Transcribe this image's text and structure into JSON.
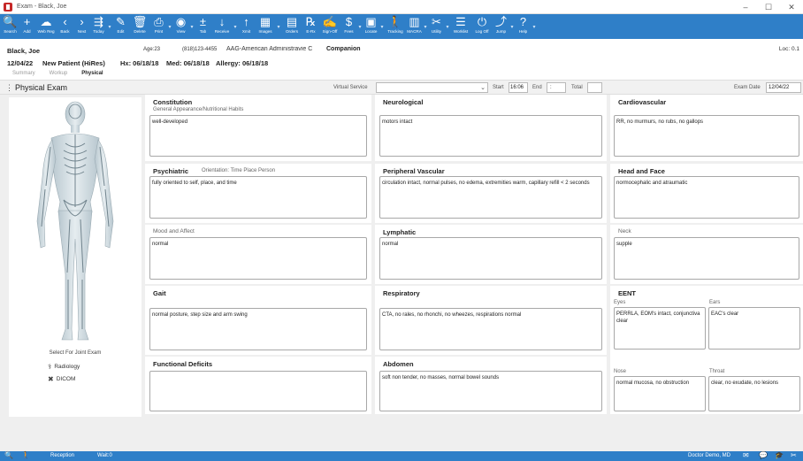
{
  "window": {
    "title": "Exam - Black, Joe",
    "controls": [
      "–",
      "☐",
      "✕"
    ]
  },
  "toolbar": [
    {
      "label": "Search",
      "icon": "🔍",
      "name": "search"
    },
    {
      "label": "Add",
      "icon": "+",
      "name": "add"
    },
    {
      "label": "Web Reg",
      "icon": "☁",
      "name": "web-reg"
    },
    {
      "label": "Back",
      "icon": "‹",
      "name": "back"
    },
    {
      "label": "Next",
      "icon": "›",
      "name": "next"
    },
    {
      "label": "Today",
      "icon": "⇶",
      "name": "today"
    },
    {
      "label": "Edit",
      "icon": "✎",
      "name": "edit"
    },
    {
      "label": "Delete",
      "icon": "🗑",
      "name": "delete"
    },
    {
      "label": "Print",
      "icon": "⎙",
      "name": "print"
    },
    {
      "label": "View",
      "icon": "◉",
      "name": "view"
    },
    {
      "label": "Tab",
      "icon": "±",
      "name": "tab"
    },
    {
      "label": "Receive",
      "icon": "↓",
      "name": "receive"
    },
    {
      "label": "Xmit",
      "icon": "↑",
      "name": "xmit"
    },
    {
      "label": "Images",
      "icon": "▦",
      "name": "images"
    },
    {
      "label": "Orders",
      "icon": "▤",
      "name": "orders"
    },
    {
      "label": "E-Rx",
      "icon": "℞",
      "name": "e-rx"
    },
    {
      "label": "Sign-Off",
      "icon": "✍",
      "name": "sign-off"
    },
    {
      "label": "Fees",
      "icon": "$",
      "name": "fees"
    },
    {
      "label": "Locate",
      "icon": "▣",
      "name": "locate"
    },
    {
      "label": "Tracking",
      "icon": "🚶",
      "name": "tracking"
    },
    {
      "label": "MACRA",
      "icon": "▥",
      "name": "macra"
    },
    {
      "label": "Utility",
      "icon": "✂",
      "name": "utility"
    },
    {
      "label": "Worklist",
      "icon": "☰",
      "name": "worklist"
    },
    {
      "label": "Log Off",
      "icon": "⏻",
      "name": "log-off"
    },
    {
      "label": "Jump",
      "icon": "⤴",
      "name": "jump"
    },
    {
      "label": "Help",
      "icon": "?",
      "name": "help"
    }
  ],
  "patient": {
    "name": "Black, Joe",
    "age": "Age:23",
    "phone": "(818)123-4455",
    "insurance": "AAG-American Administravie C",
    "companion": "Companion",
    "loc": "Loc: 0.1",
    "date": "12/04/22",
    "visit": "New Patient (HiRes)",
    "hx": "Hx: 06/18/18",
    "med": "Med: 06/18/18",
    "allergy": "Allergy: 06/18/18",
    "tabs": [
      "Summary",
      "Workup",
      "Physical"
    ]
  },
  "exam": {
    "title": "Physical Exam",
    "virtual_service_label": "Virtual Service",
    "start_label": "Start",
    "start_value": "16:06",
    "end_label": "End",
    "end_value": ":",
    "total_label": "Total",
    "exam_date_label": "Exam Date",
    "exam_date_value": "12/04/22"
  },
  "body": {
    "joint_label": "Select For Joint Exam",
    "radiology": "Radiology",
    "dicom": "DICOM"
  },
  "sections": {
    "constitution": {
      "title": "Constitution",
      "sub": "General Appearance/Nutritional Habits",
      "value": "well-developed"
    },
    "neurological": {
      "title": "Neurological",
      "value": "motors intact"
    },
    "cardiovascular": {
      "title": "Cardiovascular",
      "value": "RR, no murmurs, no rubs, no gallops"
    },
    "psychiatric": {
      "title": "Psychiatric",
      "orientation": "Orientation: Time Place Person",
      "value": "fully oriented to self, place, and time"
    },
    "peripheral": {
      "title": "Peripheral Vascular",
      "value": "circulation intact, normal pulses, no edema, extremities warm, capillary refill < 2 seconds"
    },
    "headface": {
      "title": "Head and Face",
      "value": "normocephalic and atraumatic"
    },
    "mood": {
      "title": "Mood and Affect",
      "value": "normal"
    },
    "lymphatic": {
      "title": "Lymphatic",
      "value": "normal"
    },
    "neck": {
      "title": "Neck",
      "value": "supple"
    },
    "gait": {
      "title": "Gait",
      "value": "normal posture, step size and arm swing"
    },
    "respiratory": {
      "title": "Respiratory",
      "value": "CTA, no rales, no rhonchi, no wheezes, respirations normal"
    },
    "eent": {
      "title": "EENT",
      "eyes_label": "Eyes",
      "eyes_value": "PERRLA, EOM's intact, conjunctiva clear",
      "ears_label": "Ears",
      "ears_value": "EAC's clear",
      "nose_label": "Nose",
      "nose_value": "normal mucosa, no obstruction",
      "throat_label": "Throat",
      "throat_value": "clear, no exudate, no lesions"
    },
    "functional": {
      "title": "Functional Deficits",
      "value": ""
    },
    "abdomen": {
      "title": "Abdomen",
      "value": "soft non tender, no masses, normal bowel sounds"
    }
  },
  "status": {
    "location": "Reception",
    "wait": "Wait:0",
    "user": "Doctor Demo, MD"
  }
}
